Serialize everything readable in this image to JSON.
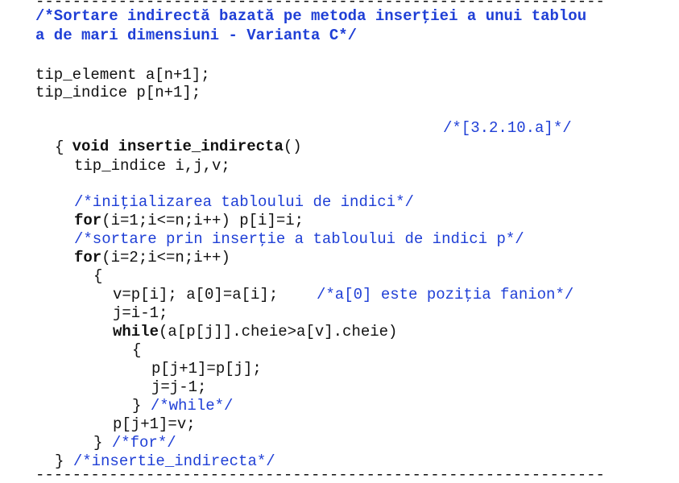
{
  "colors": {
    "comment": "#1f3fd6",
    "code": "#111111",
    "background": "#ffffff"
  },
  "rules": {
    "top": "--------------------------------------------------------------",
    "bottom": "--------------------------------------------------------------"
  },
  "header": {
    "title_line1": "/*Sortare indirectă bazată pe metoda inserţiei a unui tablou",
    "title_line2": "a de mari dimensiuni - Varianta C*/"
  },
  "declarations": {
    "line1": "tip_element a[n+1];",
    "line2": "tip_indice p[n+1];"
  },
  "function": {
    "keyword": "void",
    "name": "insertie_indirecta",
    "params": "()",
    "ref_comment": "/*[3.2.10.a]*/"
  },
  "body": {
    "open_brace": "{",
    "decl": "tip_indice i,j,v;",
    "comment_init": "/*iniţializarea tabloului de indici*/",
    "for1_kw": "for",
    "for1_rest": "(i=1;i<=n;i++) p[i]=i;",
    "comment_sort": "/*sortare prin inserţie a tabloului de indici p*/",
    "for2_kw": "for",
    "for2_rest": "(i=2;i<=n;i++)",
    "for_open": "{",
    "assign": "v=p[i]; a[0]=a[i];",
    "comment_fanion": "/*a[0] este poziţia fanion*/",
    "jdec": "j=i-1;",
    "while_kw": "while",
    "while_rest": "(a[p[j]].cheie>a[v].cheie)",
    "while_open": "{",
    "shift": "p[j+1]=p[j];",
    "jdec2": "j=j-1;",
    "while_close": "}",
    "while_comment": "/*while*/",
    "place": "p[j+1]=v;",
    "for_close": "}",
    "for_comment": "/*for*/",
    "close_brace": "}",
    "func_comment": "/*insertie_indirecta*/"
  }
}
